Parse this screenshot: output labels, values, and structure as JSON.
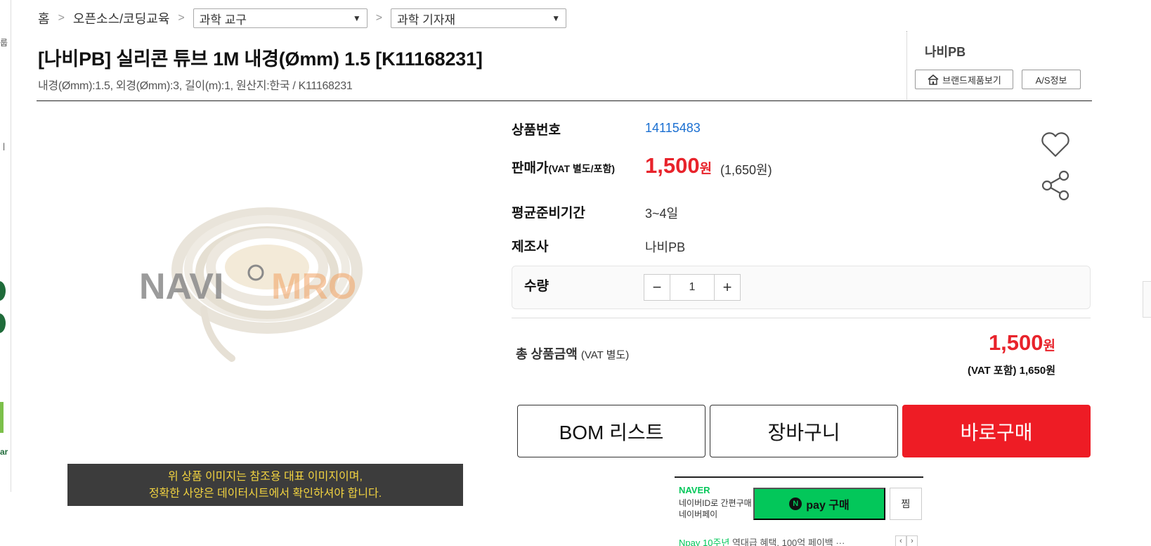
{
  "breadcrumb": {
    "home": "홈",
    "category1": "오픈소스/코딩교육",
    "category2": "과학 교구",
    "category3": "과학 기자재"
  },
  "product": {
    "title": "[나비PB] 실리콘 튜브 1M 내경(Ømm) 1.5 [K11168231]",
    "subtitle": "내경(Ømm):1.5, 외경(Ømm):3, 길이(m):1, 원산지:한국 / K11168231",
    "watermark_left": "NAVI",
    "watermark_right": "MRO",
    "image_notice_line1": "위 상품 이미지는 참조용 대표 이미지이며,",
    "image_notice_line2": "정확한 사양은 데이터시트에서 확인하셔야 합니다."
  },
  "brand": {
    "name": "나비PB",
    "brand_products_label": "브랜드제품보기",
    "as_info_label": "A/S정보"
  },
  "info": {
    "product_no_label": "상품번호",
    "product_no": "14115483",
    "price_label": "판매가",
    "price_label_note": "(VAT 별도/포함)",
    "price": "1,500",
    "price_unit": "원",
    "price_vat": "(1,650원)",
    "lead_time_label": "평균준비기간",
    "lead_time": "3~4일",
    "maker_label": "제조사",
    "maker": "나비PB"
  },
  "quantity": {
    "label": "수량",
    "value": "1",
    "minus": "−",
    "plus": "+"
  },
  "total": {
    "label": "총 상품금액",
    "label_note": "(VAT 별도)",
    "price": "1,500",
    "unit": "원",
    "vat_line": "(VAT 포함) 1,650원"
  },
  "actions": {
    "bom": "BOM 리스트",
    "cart": "장바구니",
    "buy": "바로구매"
  },
  "naver": {
    "logo": "NAVER",
    "sub_line1": "네이버ID로 간편구매",
    "sub_line2": "네이버페이",
    "pay_label": "pay 구매",
    "pay_n": "N",
    "zzim": "찜",
    "promo_green": "Npay 10주년",
    "promo_text": " 역대급 혜택, 100억 페이백 ···",
    "prev": "‹",
    "next": "›"
  },
  "sidebar_fragments": {
    "a": "룹",
    "b": "ㅣ",
    "c": "ar"
  },
  "colors": {
    "price_red": "#e8232b",
    "buy_red": "#ee1c25",
    "link_blue": "#1a6fd1",
    "naver_green": "#03c75a",
    "notice_yellow": "#f2d340"
  }
}
